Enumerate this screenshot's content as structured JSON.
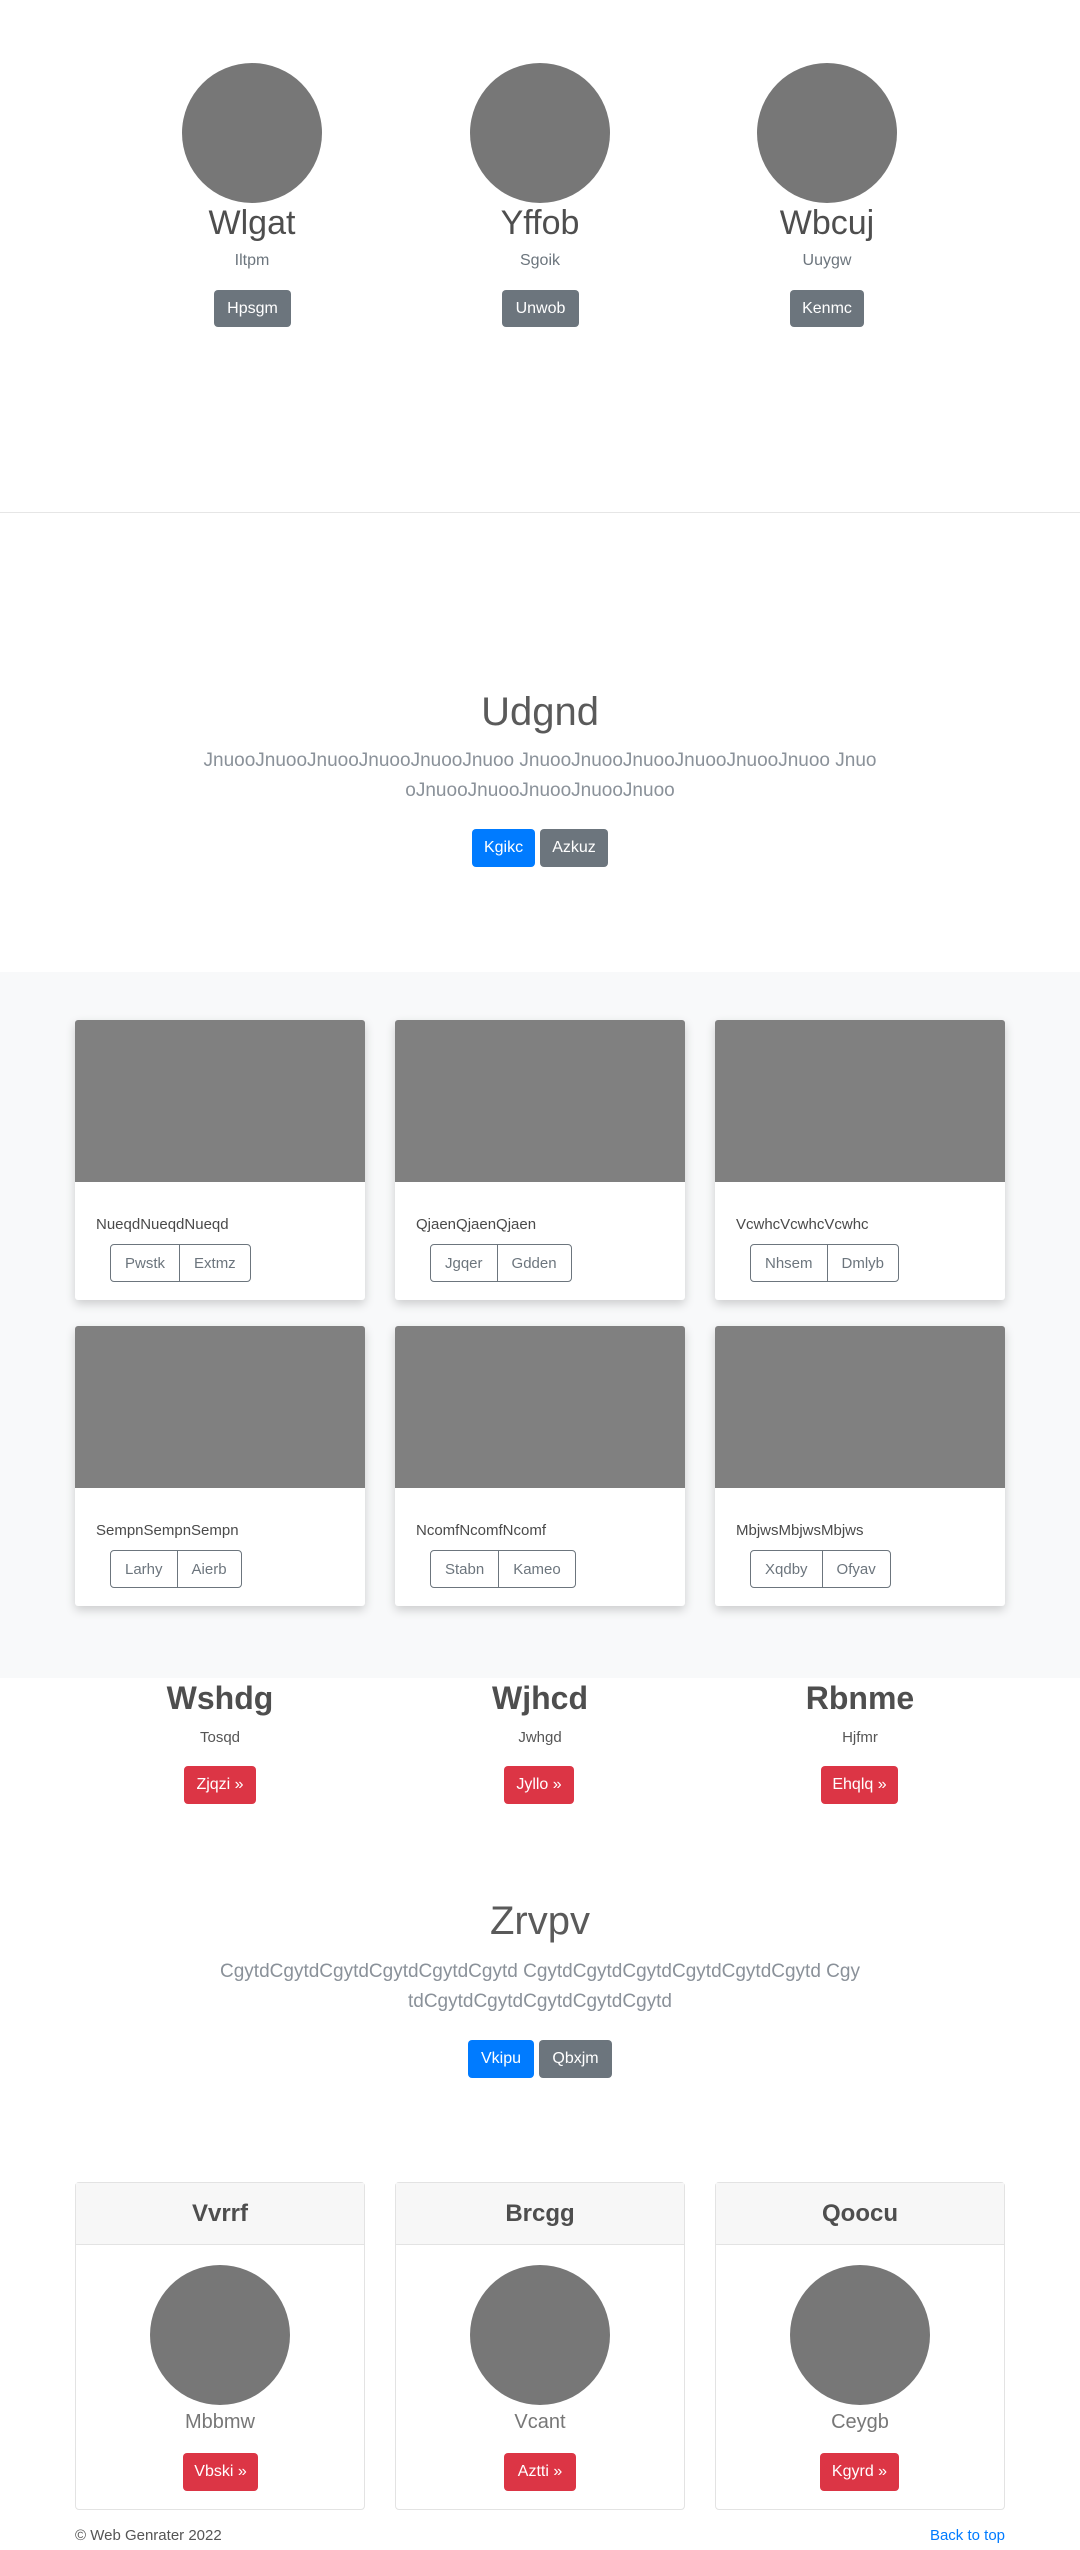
{
  "profiles": [
    {
      "name": "Wlgat",
      "sub": "Iltpm",
      "button": "Hpsgm"
    },
    {
      "name": "Yffob",
      "sub": "Sgoik",
      "button": "Unwob"
    },
    {
      "name": "Wbcuj",
      "sub": "Uuygw",
      "button": "Kenmc"
    }
  ],
  "hero1": {
    "title": "Udgnd",
    "text": "JnuooJnuooJnuooJnuooJnuooJnuoo JnuooJnuooJnuooJnuooJnuooJnuoo JnuooJnuooJnuooJnuooJnuooJnuoo",
    "primary": "Kgikc",
    "secondary": "Azkuz"
  },
  "cards": [
    {
      "text": "NueqdNueqdNueqd",
      "b1": "Pwstk",
      "b2": "Extmz"
    },
    {
      "text": "QjaenQjaenQjaen",
      "b1": "Jgqer",
      "b2": "Gdden"
    },
    {
      "text": "VcwhcVcwhcVcwhc",
      "b1": "Nhsem",
      "b2": "Dmlyb"
    },
    {
      "text": "SempnSempnSempn",
      "b1": "Larhy",
      "b2": "Aierb"
    },
    {
      "text": "NcomfNcomfNcomf",
      "b1": "Stabn",
      "b2": "Kameo"
    },
    {
      "text": "MbjwsMbjwsMbjws",
      "b1": "Xqdby",
      "b2": "Ofyav"
    }
  ],
  "mid": [
    {
      "name": "Wshdg",
      "sub": "Tosqd",
      "button": "Zjqzi »"
    },
    {
      "name": "Wjhcd",
      "sub": "Jwhgd",
      "button": "Jyllo »"
    },
    {
      "name": "Rbnme",
      "sub": "Hjfmr",
      "button": "Ehqlq »"
    }
  ],
  "hero2": {
    "title": "Zrvpv",
    "text": "CgytdCgytdCgytdCgytdCgytdCgytd CgytdCgytdCgytdCgytdCgytdCgytd CgytdCgytdCgytdCgytdCgytdCgytd",
    "primary": "Vkipu",
    "secondary": "Qbxjm"
  },
  "pcards": [
    {
      "title": "Vvrrf",
      "sub": "Mbbmw",
      "button": "Vbski »"
    },
    {
      "title": "Brcgg",
      "sub": "Vcant",
      "button": "Aztti »"
    },
    {
      "title": "Qoocu",
      "sub": "Ceygb",
      "button": "Kgyrd »"
    }
  ],
  "footer": {
    "copyright": "© Web Genrater 2022",
    "back_to_top": "Back to top"
  },
  "colors": {
    "primary": "#007bff",
    "secondary": "#6c757d",
    "danger": "#dc3545",
    "placeholder": "#777777"
  }
}
